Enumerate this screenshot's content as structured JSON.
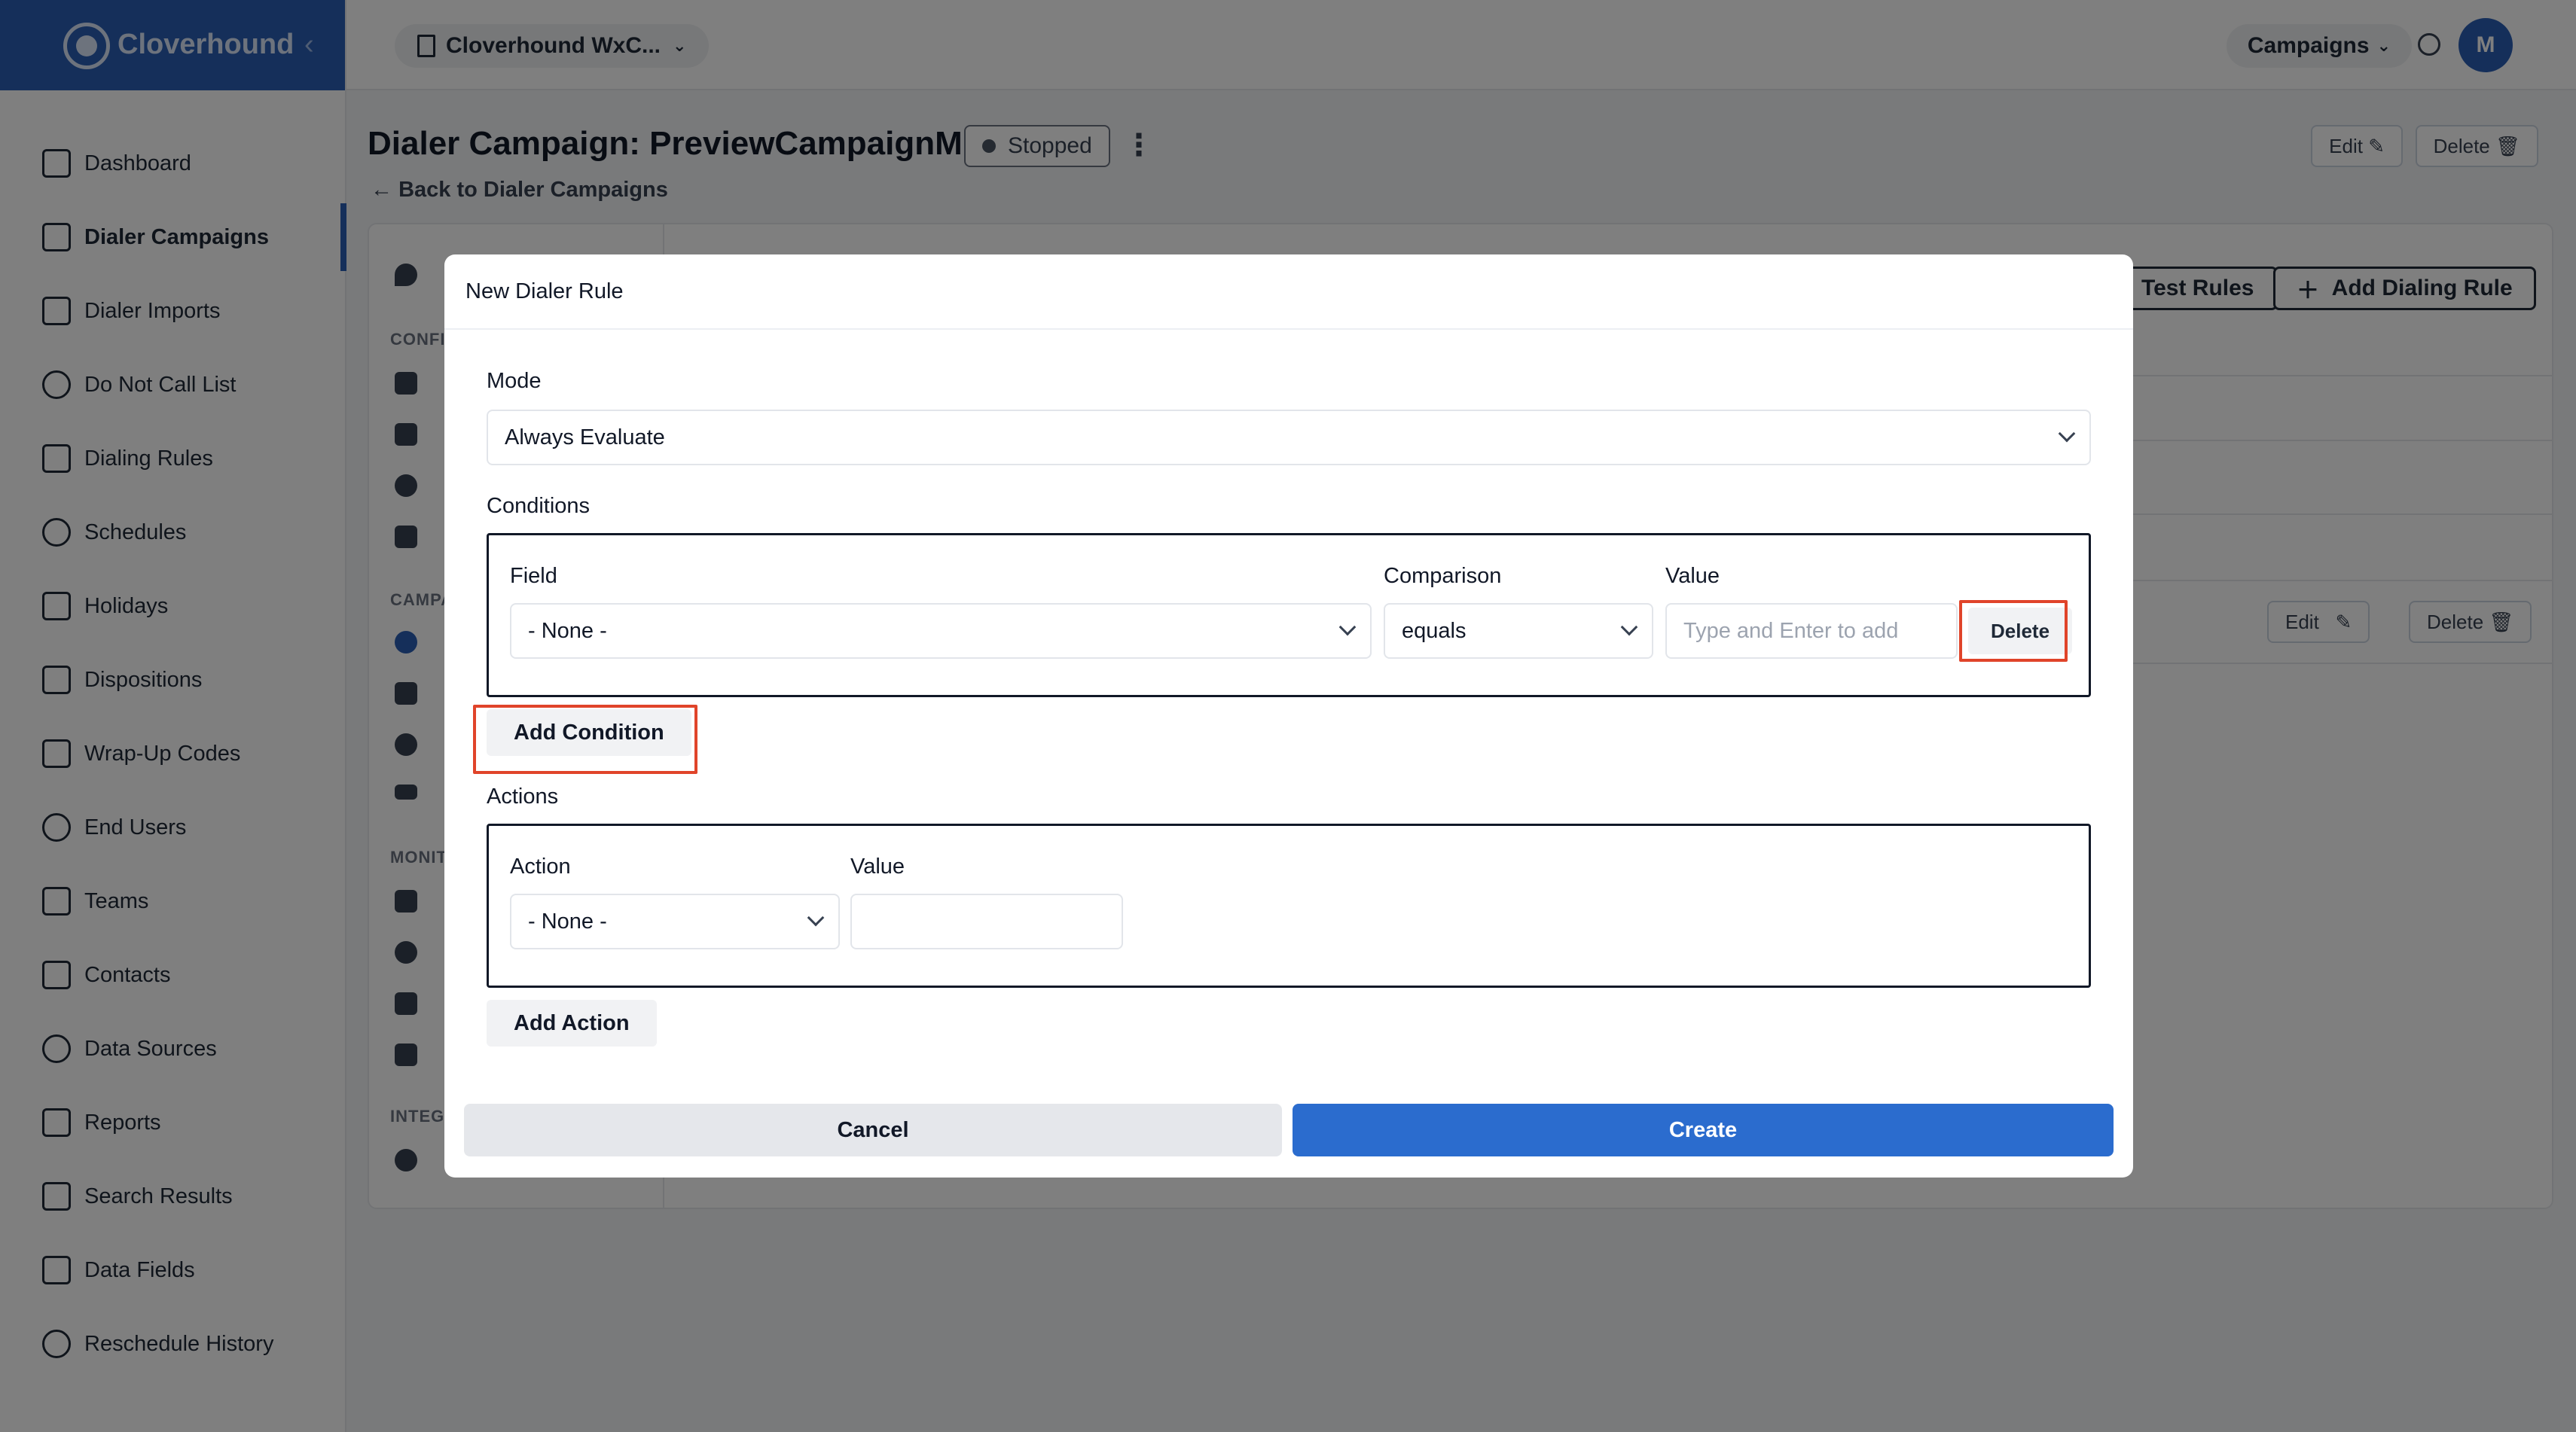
{
  "brand": {
    "name": "Cloverhound",
    "collapse_icon": "chevron-left-icon"
  },
  "sidebar": {
    "items": [
      {
        "label": "Dashboard",
        "icon": "bar-chart-icon",
        "active": false
      },
      {
        "label": "Dialer Campaigns",
        "icon": "megaphone-icon",
        "active": true
      },
      {
        "label": "Dialer Imports",
        "icon": "import-icon",
        "active": false
      },
      {
        "label": "Do Not Call List",
        "icon": "ban-icon",
        "active": false
      },
      {
        "label": "Dialing Rules",
        "icon": "shield-check-icon",
        "active": false
      },
      {
        "label": "Schedules",
        "icon": "clock-icon",
        "active": false
      },
      {
        "label": "Holidays",
        "icon": "calendar-icon",
        "active": false
      },
      {
        "label": "Dispositions",
        "icon": "clipboard-icon",
        "active": false
      },
      {
        "label": "Wrap-Up Codes",
        "icon": "clipboard-check-icon",
        "active": false
      },
      {
        "label": "End Users",
        "icon": "headset-icon",
        "active": false
      },
      {
        "label": "Teams",
        "icon": "users-icon",
        "active": false
      },
      {
        "label": "Contacts",
        "icon": "contact-card-icon",
        "active": false
      },
      {
        "label": "Data Sources",
        "icon": "cloud-icon",
        "active": false
      },
      {
        "label": "Reports",
        "icon": "report-icon",
        "active": false
      },
      {
        "label": "Search Results",
        "icon": "search-doc-icon",
        "active": false
      },
      {
        "label": "Data Fields",
        "icon": "table-icon",
        "active": false
      },
      {
        "label": "Reschedule History",
        "icon": "history-icon",
        "active": false
      }
    ]
  },
  "topbar": {
    "workspace": "Cloverhound WxC...",
    "campaigns_menu": "Campaigns",
    "avatar_initial": "M"
  },
  "page": {
    "title": "Dialer Campaign: PreviewCampaignM",
    "status": "Stopped",
    "back_link": "Back to Dialer Campaigns",
    "edit": "Edit",
    "delete": "Delete"
  },
  "background": {
    "test_rules": "Test Rules",
    "add_dialing_rule": "Add Dialing Rule",
    "row_edit": "Edit",
    "row_delete": "Delete"
  },
  "modal": {
    "title": "New Dialer Rule",
    "mode_label": "Mode",
    "mode_value": "Always Evaluate",
    "conditions_label": "Conditions",
    "condition": {
      "field_label": "Field",
      "field_value": "- None -",
      "comparison_label": "Comparison",
      "comparison_value": "equals",
      "value_label": "Value",
      "value_placeholder": "Type and Enter to add",
      "delete": "Delete"
    },
    "add_condition": "Add Condition",
    "actions_label": "Actions",
    "action": {
      "action_label": "Action",
      "action_value": "- None -",
      "value_label": "Value",
      "value_value": ""
    },
    "add_action": "Add Action",
    "cancel": "Cancel",
    "create": "Create"
  },
  "colors": {
    "brand": "#2b5fb5",
    "primary_button": "#2b6cce",
    "highlight": "#e0442a"
  }
}
